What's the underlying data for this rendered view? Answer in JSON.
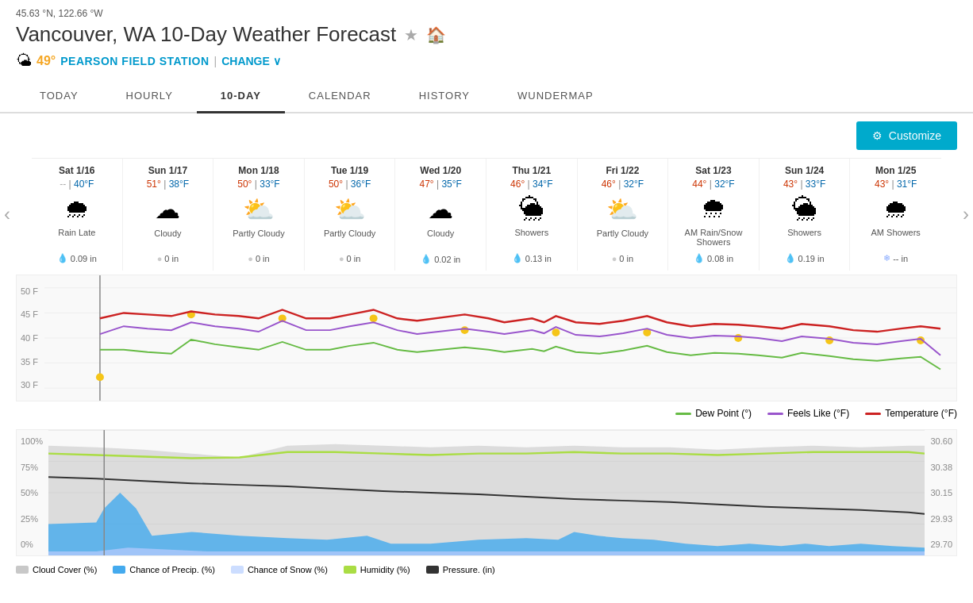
{
  "header": {
    "coords": "45.63 °N, 122.66 °W",
    "title": "Vancouver, WA 10-Day Weather Forecast",
    "temp": "49°",
    "station": "PEARSON FIELD STATION",
    "change": "CHANGE"
  },
  "nav": {
    "tabs": [
      {
        "label": "TODAY",
        "active": false
      },
      {
        "label": "HOURLY",
        "active": false
      },
      {
        "label": "10-DAY",
        "active": true
      },
      {
        "label": "CALENDAR",
        "active": false
      },
      {
        "label": "HISTORY",
        "active": false
      },
      {
        "label": "WUNDERMAP",
        "active": false
      }
    ]
  },
  "toolbar": {
    "customize_label": "Customize"
  },
  "days": [
    {
      "name": "Sat 1/16",
      "high": "--",
      "low": "40°F",
      "desc": "Rain Late",
      "precip": "0.09 in",
      "precip_type": "rain",
      "icon": "🌧"
    },
    {
      "name": "Sun 1/17",
      "high": "51°",
      "low": "38°F",
      "desc": "Cloudy",
      "precip": "0 in",
      "precip_type": "none",
      "icon": "☁"
    },
    {
      "name": "Mon 1/18",
      "high": "50°",
      "low": "33°F",
      "desc": "Partly Cloudy",
      "precip": "0 in",
      "precip_type": "none",
      "icon": "⛅"
    },
    {
      "name": "Tue 1/19",
      "high": "50°",
      "low": "36°F",
      "desc": "Partly Cloudy",
      "precip": "0 in",
      "precip_type": "none",
      "icon": "⛅"
    },
    {
      "name": "Wed 1/20",
      "high": "47°",
      "low": "35°F",
      "desc": "Cloudy",
      "precip": "0.02 in",
      "precip_type": "rain",
      "icon": "☁"
    },
    {
      "name": "Thu 1/21",
      "high": "46°",
      "low": "34°F",
      "desc": "Showers",
      "precip": "0.13 in",
      "precip_type": "rain",
      "icon": "🌦"
    },
    {
      "name": "Fri 1/22",
      "high": "46°",
      "low": "32°F",
      "desc": "Partly Cloudy",
      "precip": "0 in",
      "precip_type": "none",
      "icon": "⛅"
    },
    {
      "name": "Sat 1/23",
      "high": "44°",
      "low": "32°F",
      "desc": "AM Rain/Snow Showers",
      "precip": "0.08 in",
      "precip_type": "rain",
      "icon": "🌨"
    },
    {
      "name": "Sun 1/24",
      "high": "43°",
      "low": "33°F",
      "desc": "Showers",
      "precip": "0.19 in",
      "precip_type": "rain",
      "icon": "🌦"
    },
    {
      "name": "Mon 1/25",
      "high": "43°",
      "low": "31°F",
      "desc": "AM Showers",
      "precip": "-- in",
      "precip_type": "snow",
      "icon": "🌧"
    }
  ],
  "chart_labels": {
    "y_axis": [
      "50 F",
      "45 F",
      "40 F",
      "35 F",
      "30 F"
    ]
  },
  "legend": {
    "items": [
      {
        "label": "Dew Point (°)",
        "color": "#66bb44"
      },
      {
        "label": "Feels Like (°F)",
        "color": "#9955cc"
      },
      {
        "label": "Temperature (°F)",
        "color": "#cc2222"
      }
    ]
  },
  "lower_chart": {
    "left_labels": [
      "100%",
      "75%",
      "50%",
      "25%",
      "0%"
    ],
    "right_labels": [
      "30.60",
      "30.38",
      "30.15",
      "29.93",
      "29.70"
    ]
  },
  "lower_legend": {
    "items": [
      {
        "label": "Cloud Cover (%)",
        "color": "#c8c8c8"
      },
      {
        "label": "Chance of Precip. (%)",
        "color": "#44aaee"
      },
      {
        "label": "Chance of Snow (%)",
        "color": "#ccddff"
      },
      {
        "label": "Humidity (%)",
        "color": "#aadd44"
      },
      {
        "label": "Pressure. (in)",
        "color": "#333333"
      }
    ]
  }
}
